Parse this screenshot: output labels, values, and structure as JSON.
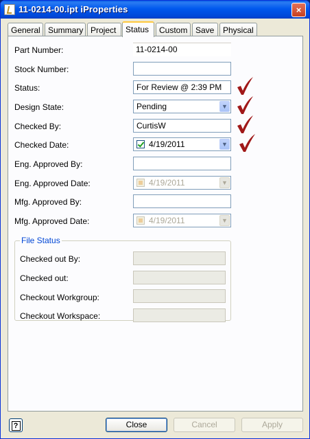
{
  "window": {
    "title": "11-0214-00.ipt iProperties",
    "close_glyph": "×"
  },
  "tabs": [
    {
      "label": "General"
    },
    {
      "label": "Summary"
    },
    {
      "label": "Project"
    },
    {
      "label": "Status",
      "active": true
    },
    {
      "label": "Custom"
    },
    {
      "label": "Save"
    },
    {
      "label": "Physical"
    }
  ],
  "fields": {
    "part_number": {
      "label": "Part Number:",
      "value": "11-0214-00"
    },
    "stock_number": {
      "label": "Stock Number:",
      "value": ""
    },
    "status": {
      "label": "Status:",
      "value": "For Review @ 2:39 PM"
    },
    "design_state": {
      "label": "Design State:",
      "value": "Pending"
    },
    "checked_by": {
      "label": "Checked By:",
      "value": "CurtisW"
    },
    "checked_date": {
      "label": "Checked Date:",
      "value": "4/19/2011",
      "checked": true
    },
    "eng_approved_by": {
      "label": "Eng. Approved By:",
      "value": ""
    },
    "eng_approved_date": {
      "label": "Eng. Approved Date:",
      "value": "4/19/2011",
      "checked": false
    },
    "mfg_approved_by": {
      "label": "Mfg. Approved By:",
      "value": ""
    },
    "mfg_approved_date": {
      "label": "Mfg. Approved Date:",
      "value": "4/19/2011",
      "checked": false
    }
  },
  "file_status": {
    "title": "File Status",
    "checked_out_by": {
      "label": "Checked out By:",
      "value": ""
    },
    "checked_out": {
      "label": "Checked out:",
      "value": ""
    },
    "checkout_workgroup": {
      "label": "Checkout Workgroup:",
      "value": ""
    },
    "checkout_workspace": {
      "label": "Checkout Workspace:",
      "value": ""
    }
  },
  "annotations": {
    "checkmark_color": "#a01818",
    "checkmark_count": 4
  },
  "buttons": {
    "help_glyph": "?",
    "close": "Close",
    "cancel": "Cancel",
    "apply": "Apply"
  },
  "icons": {
    "dropdown": "▼"
  }
}
